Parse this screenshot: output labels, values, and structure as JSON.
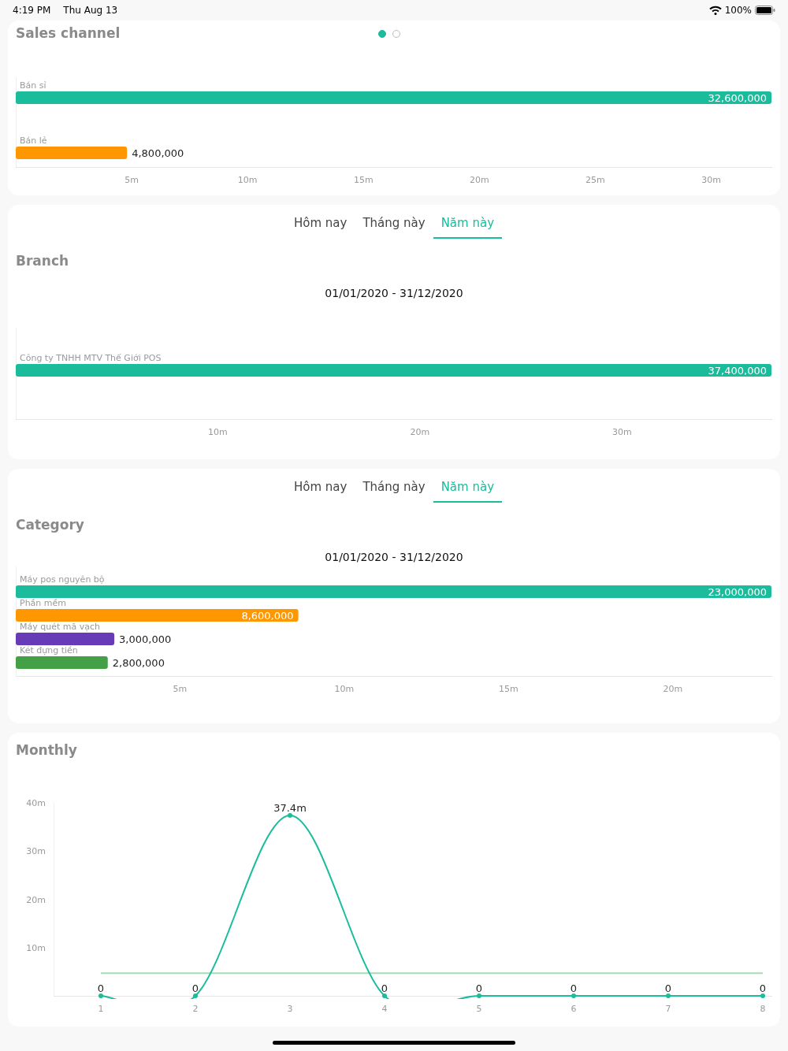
{
  "status_bar": {
    "time": "4:19 PM",
    "date": "Thu Aug 13",
    "battery": "100%"
  },
  "sales_channel": {
    "title": "Sales channel",
    "pager": [
      {
        "selected": true
      },
      {
        "selected": false
      }
    ],
    "chart_data": {
      "type": "bar",
      "orientation": "horizontal",
      "categories": [
        "Bán sỉ",
        "Bán lẻ"
      ],
      "values": [
        32600000,
        4800000
      ],
      "colors": [
        "#1abc9c",
        "#ff9800"
      ],
      "value_labels": [
        "32,600,000",
        "4,800,000"
      ],
      "xlim": [
        0,
        32600000
      ],
      "xticks": [
        {
          "value": 5000000,
          "label": "5m"
        },
        {
          "value": 10000000,
          "label": "10m"
        },
        {
          "value": 15000000,
          "label": "15m"
        },
        {
          "value": 20000000,
          "label": "20m"
        },
        {
          "value": 25000000,
          "label": "25m"
        },
        {
          "value": 30000000,
          "label": "30m"
        }
      ]
    }
  },
  "branch": {
    "tabs": [
      {
        "label": "Hôm nay",
        "selected": false
      },
      {
        "label": "Tháng này",
        "selected": false
      },
      {
        "label": "Năm này",
        "selected": true
      }
    ],
    "title": "Branch",
    "date_range": "01/01/2020 - 31/12/2020",
    "chart_data": {
      "type": "bar",
      "orientation": "horizontal",
      "categories": [
        "Công ty TNHH MTV Thế Giới POS"
      ],
      "values": [
        37400000
      ],
      "colors": [
        "#1abc9c"
      ],
      "value_labels": [
        "37,400,000"
      ],
      "xlim": [
        0,
        37400000
      ],
      "xticks": [
        {
          "value": 10000000,
          "label": "10m"
        },
        {
          "value": 20000000,
          "label": "20m"
        },
        {
          "value": 30000000,
          "label": "30m"
        }
      ]
    }
  },
  "category": {
    "tabs": [
      {
        "label": "Hôm nay",
        "selected": false
      },
      {
        "label": "Tháng này",
        "selected": false
      },
      {
        "label": "Năm này",
        "selected": true
      }
    ],
    "title": "Category",
    "date_range": "01/01/2020 - 31/12/2020",
    "chart_data": {
      "type": "bar",
      "orientation": "horizontal",
      "categories": [
        "Máy pos nguyên bộ",
        "Phần mềm",
        "Máy quét mã vạch",
        "Két đựng tiền"
      ],
      "values": [
        23000000,
        8600000,
        3000000,
        2800000
      ],
      "colors": [
        "#1abc9c",
        "#ff9800",
        "#673ab7",
        "#43a047"
      ],
      "value_labels": [
        "23,000,000",
        "8,600,000",
        "3,000,000",
        "2,800,000"
      ],
      "xlim": [
        0,
        23000000
      ],
      "xticks": [
        {
          "value": 5000000,
          "label": "5m"
        },
        {
          "value": 10000000,
          "label": "10m"
        },
        {
          "value": 15000000,
          "label": "15m"
        },
        {
          "value": 20000000,
          "label": "20m"
        }
      ]
    }
  },
  "monthly": {
    "title": "Monthly",
    "chart_data": {
      "type": "line",
      "x": [
        1,
        2,
        3,
        4,
        5,
        6,
        7,
        8
      ],
      "series": [
        {
          "color": "#1abc9c",
          "marker": true,
          "values": [
            0,
            0,
            37400000,
            0,
            0,
            0,
            0,
            0
          ]
        }
      ],
      "value_labels": [
        "0",
        "0",
        "37.4m",
        "0",
        "0",
        "0",
        "0",
        "0"
      ],
      "xlim": [
        0.5,
        8.1
      ],
      "ylim": [
        0,
        40000000
      ],
      "yticks": [
        {
          "value": 10000000,
          "label": "10m"
        },
        {
          "value": 20000000,
          "label": "20m"
        },
        {
          "value": 30000000,
          "label": "30m"
        },
        {
          "value": 40000000,
          "label": "40m"
        }
      ],
      "xticks": [
        {
          "value": 1,
          "label": "1"
        },
        {
          "value": 2,
          "label": "2"
        },
        {
          "value": 3,
          "label": "3"
        },
        {
          "value": 4,
          "label": "4"
        },
        {
          "value": 5,
          "label": "5"
        },
        {
          "value": 6,
          "label": "6"
        },
        {
          "value": 7,
          "label": "7"
        },
        {
          "value": 8,
          "label": "8"
        }
      ],
      "ref_lines": [
        {
          "axis": "y",
          "value": 4675000,
          "color": "#a5dcb0"
        }
      ]
    }
  }
}
